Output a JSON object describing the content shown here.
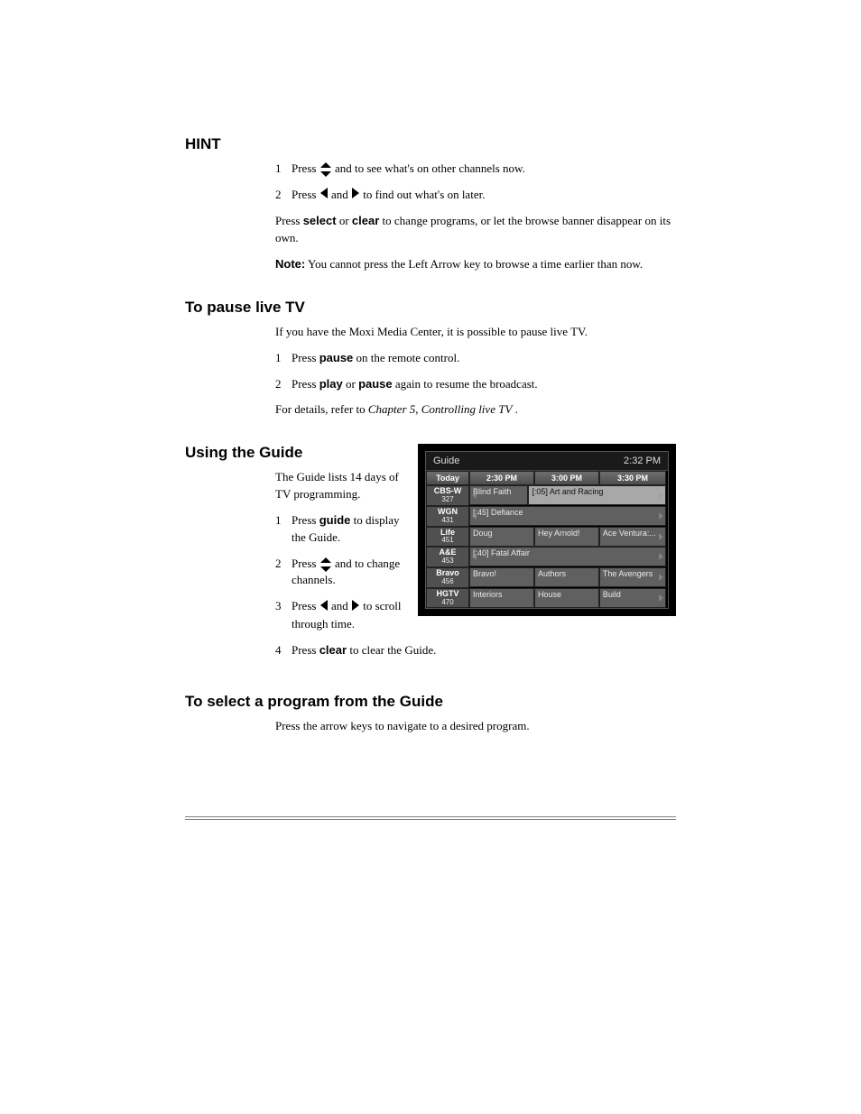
{
  "hint": {
    "title": "HINT",
    "s1": {
      "n": "1",
      "prefix": "Press ",
      "and_text": " and ",
      "suffix": " to see what's on other channels now."
    },
    "s2": {
      "n": "2",
      "prefix": "Press ",
      "and_text": " and ",
      "suffix": " to find out what's on later."
    },
    "s3_pre": "Press ",
    "s3_mid": " or ",
    "s3_suf": " to change programs, or let the browse banner disappear on its own.",
    "select": "select",
    "clear": "clear",
    "note_label": "Note:",
    "note_body": " You cannot press the Left Arrow key to browse a time earlier than now."
  },
  "pause": {
    "title": "To pause live TV",
    "p1": "If you have the Moxi Media Center, it is possible to pause live TV.",
    "s1": {
      "n": "1",
      "pre": "Press ",
      "suf": " on the remote control.",
      "pause": "pause"
    },
    "s2": {
      "n": "2",
      "pre": "Press ",
      "mid": " or ",
      "suf": " again to resume the broadcast.",
      "play": "play",
      "pause": "pause"
    },
    "p2_a": "For details, refer to ",
    "p2_i": "Chapter 5, Controlling live TV",
    "p2_b": "."
  },
  "guide_ui": {
    "title": "Guide",
    "time": "2:32 PM",
    "timebar": {
      "day": "Today",
      "t1": "2:30 PM",
      "t2": "3:00 PM",
      "t3": "3:30 PM"
    },
    "rows": [
      {
        "ch": "CBS-W",
        "num": "327",
        "p": [
          {
            "l": 0,
            "w": 0.3,
            "t": "Blind Faith",
            "hl": false,
            "larr": true
          },
          {
            "l": 0.3,
            "w": 0.7,
            "t": "[:05] Art and Racing",
            "hl": true,
            "arr": true
          }
        ]
      },
      {
        "ch": "WGN",
        "num": "431",
        "p": [
          {
            "l": 0,
            "w": 1.0,
            "t": "[:45] Defiance",
            "hl": false,
            "larr": true,
            "arr": true
          }
        ]
      },
      {
        "ch": "Life",
        "num": "451",
        "p": [
          {
            "l": 0,
            "w": 0.33,
            "t": "Doug",
            "hl": false
          },
          {
            "l": 0.33,
            "w": 0.33,
            "t": "Hey Arnold!",
            "hl": false
          },
          {
            "l": 0.66,
            "w": 0.34,
            "t": "Ace Ventura:...",
            "hl": false,
            "arr": true
          }
        ]
      },
      {
        "ch": "A&E",
        "num": "453",
        "p": [
          {
            "l": 0,
            "w": 1.0,
            "t": "[:40] Fatal Affair",
            "hl": false,
            "larr": true,
            "arr": true
          }
        ]
      },
      {
        "ch": "Bravo",
        "num": "456",
        "p": [
          {
            "l": 0,
            "w": 0.33,
            "t": "Bravo!",
            "hl": false
          },
          {
            "l": 0.33,
            "w": 0.33,
            "t": "Authors",
            "hl": false
          },
          {
            "l": 0.66,
            "w": 0.34,
            "t": "The Avengers",
            "hl": false,
            "arr": true
          }
        ]
      },
      {
        "ch": "HGTV",
        "num": "470",
        "p": [
          {
            "l": 0,
            "w": 0.33,
            "t": "Interiors",
            "hl": false
          },
          {
            "l": 0.33,
            "w": 0.33,
            "t": "House",
            "hl": false
          },
          {
            "l": 0.66,
            "w": 0.34,
            "t": "Build",
            "hl": false,
            "arr": true
          }
        ]
      }
    ]
  },
  "guide_section": {
    "title": "Using the Guide",
    "p1": "The Guide lists 14 days of TV programming.",
    "s1": {
      "n": "1",
      "pre": "Press ",
      "suf": " to display the Guide.",
      "btn": "guide"
    },
    "s2": {
      "n": "2",
      "pre": "Press ",
      "and": " and ",
      "suf": " to change channels."
    },
    "s3": {
      "n": "3",
      "pre": "Press ",
      "and": " and ",
      "suf": " to scroll through time."
    },
    "s4": {
      "n": "4",
      "pre": "Press ",
      "suf": " to clear the Guide.",
      "btn": "clear"
    }
  },
  "select_section": {
    "title": "To select a program from the Guide",
    "p": "Press the arrow keys to navigate to a desired program."
  }
}
